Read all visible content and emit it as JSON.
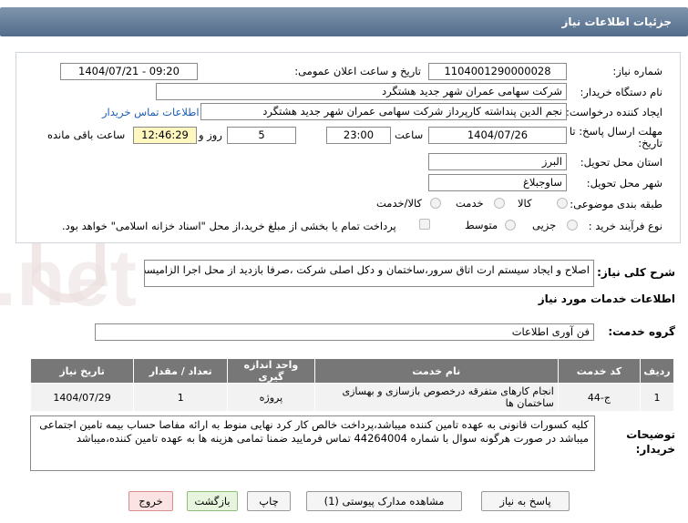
{
  "window": {
    "title": "جزئیات اطلاعات نیاز"
  },
  "form": {
    "need_number_label": "شماره نیاز:",
    "need_number": "1104001290000028",
    "announce_label": "تاریخ و ساعت اعلان عمومی:",
    "announce_value": "1404/07/21 - 09:20",
    "buyer_org_label": "نام دستگاه خریدار:",
    "buyer_org": "شرکت سهامی عمران شهر جدید هشتگرد",
    "creator_label": "ایجاد کننده درخواست:",
    "creator": "نجم الدین پنداشته کارپرداز شرکت سهامی عمران شهر جدید هشتگرد",
    "contact_link": "اطلاعات تماس خریدار",
    "deadline_label_1": "مهلت ارسال پاسخ: تا",
    "deadline_label_2": "تاریخ:",
    "deadline_date": "1404/07/26",
    "time_label": "ساعت",
    "deadline_time": "23:00",
    "days": "5",
    "days_label": "روز و",
    "remaining_time": "12:46:29",
    "remaining_label": "ساعت باقی مانده",
    "province_label": "استان محل تحویل:",
    "province": "البرز",
    "city_label": "شهر محل تحویل:",
    "city": "ساوجبلاغ",
    "category_label": "طبقه بندی موضوعی:",
    "category_options": [
      "کالا",
      "خدمت",
      "کالا/خدمت"
    ],
    "process_label": "نوع فرآیند خرید :",
    "process_options": [
      "جزیی",
      "متوسط"
    ],
    "payment_note": "پرداخت تمام یا بخشی از مبلغ خرید،از محل \"اسناد خزانه اسلامی\" خواهد بود.",
    "summary_label": "شرح کلی نیاز:",
    "summary": "اصلاح و ایجاد سیستم ارت اتاق سرور،ساختمان و دکل اصلی شرکت ،صرفا بازدید از محل اجرا الزامیست",
    "services_title": "اطلاعات خدمات مورد نیاز",
    "service_group_label": "گروه خدمت:",
    "service_group": "فن آوری اطلاعات",
    "buyer_notes_label_1": "توضیحات",
    "buyer_notes_label_2": "خریدار:",
    "buyer_notes": "کلیه کسورات قانونی به عهده تامین کننده میباشد،پرداخت خالص کار کرد نهایی منوط به ارائه مفاصا حساب بیمه تامین اجتماعی میباشد در صورت هرگونه سوال با شماره 44264004 تماس فرمایید ضمنا تمامی هزینه ها به عهده تامین کننده،میباشد"
  },
  "table": {
    "headers": [
      "ردیف",
      "کد خدمت",
      "نام خدمت",
      "واحد اندازه گیری",
      "تعداد / مقدار",
      "تاریخ نیاز"
    ],
    "rows": [
      [
        "1",
        "ج-44",
        "انجام کارهای متفرقه درخصوص بازسازی و بهسازی ساختمان ها",
        "پروژه",
        "1",
        "1404/07/29"
      ]
    ]
  },
  "buttons": {
    "reply": "پاسخ به نیاز",
    "attachments": "مشاهده مدارک پیوستی (1)",
    "print": "چاپ",
    "back": "بازگشت",
    "exit": "خروج"
  },
  "watermark": {
    "brand": "AriaTender.net"
  },
  "colors": {
    "header": "#5b7391",
    "time_bg": "#fff7c0",
    "link": "#1a5fb4",
    "watermark": "#e7d5d5"
  }
}
